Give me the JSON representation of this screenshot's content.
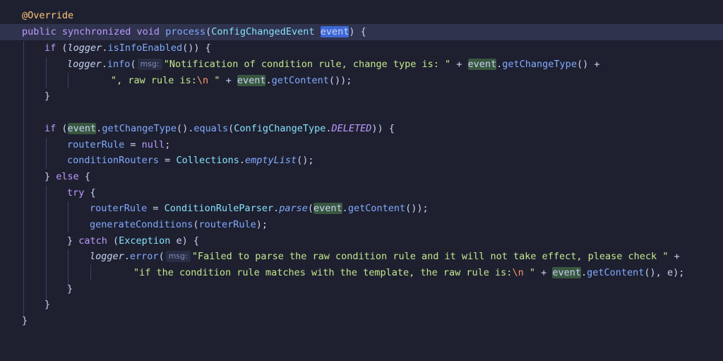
{
  "editor": {
    "theme_colors": {
      "background": "#1e2030",
      "current_line": "#2f334d",
      "keyword": "#c099ff",
      "string": "#c3e88d",
      "function": "#82aaff",
      "annotation": "#ffc777"
    },
    "param_hint": "msg:",
    "lines": {
      "l1": {
        "ann": "@Override"
      },
      "l2": {
        "kw": "public synchronized void ",
        "fn": "process",
        "p1": "(",
        "ty": "ConfigChangedEvent ",
        "var": "event",
        "p2": ") {"
      },
      "l3": {
        "kw": "if ",
        "p1": "(",
        "obj": "logger",
        "p2": ".",
        "fn": "isInfoEnabled",
        "p3": "()) {"
      },
      "l4": {
        "obj": "logger",
        "p1": ".",
        "fn": "info",
        "p2": "(",
        "str": "\"Notification of condition rule, change type is: \"",
        "op": " + ",
        "var": "event",
        "p3": ".",
        "fn2": "getChangeType",
        "p4": "() +"
      },
      "l5": {
        "str1": "\", raw rule is:",
        "esc": "\\n",
        "str2": " \"",
        "op": " + ",
        "var": "event",
        "p1": ".",
        "fn": "getContent",
        "p2": "());"
      },
      "l6": {
        "p1": "}"
      },
      "l8": {
        "kw": "if ",
        "p1": "(",
        "var": "event",
        "p2": ".",
        "fn": "getChangeType",
        "p3": "().",
        "fn2": "equals",
        "p4": "(",
        "ty": "ConfigChangeType",
        "p5": ".",
        "const": "DELETED",
        "p6": ")) {"
      },
      "l9": {
        "fld": "routerRule",
        "op": " = ",
        "kw": "null",
        "p1": ";"
      },
      "l10": {
        "fld": "conditionRouters",
        "op": " = ",
        "ty": "Collections",
        "p1": ".",
        "fn": "emptyList",
        "p2": "();"
      },
      "l11": {
        "p1": "} ",
        "kw": "else",
        "p2": " {"
      },
      "l12": {
        "kw": "try",
        "p1": " {"
      },
      "l13": {
        "fld": "routerRule",
        "op": " = ",
        "ty": "ConditionRuleParser",
        "p1": ".",
        "fn": "parse",
        "p2": "(",
        "var": "event",
        "p3": ".",
        "fn2": "getContent",
        "p4": "());"
      },
      "l14": {
        "fn": "generateConditions",
        "p1": "(",
        "fld": "routerRule",
        "p2": ");"
      },
      "l15": {
        "p1": "} ",
        "kw": "catch",
        "p2": " (",
        "ty": "Exception",
        "var": " e",
        "p3": ") {"
      },
      "l16": {
        "obj": "logger",
        "p1": ".",
        "fn": "error",
        "p2": "(",
        "str": "\"Failed to parse the raw condition rule and it will not take effect, please check \"",
        "op": " +"
      },
      "l17": {
        "str1": "\"if the condition rule matches with the template, the raw rule is:",
        "esc": "\\n",
        "str2": " \"",
        "op": " + ",
        "var": "event",
        "p1": ".",
        "fn": "getContent",
        "p2": "(), ",
        "var2": "e",
        "p3": ");"
      },
      "l18": {
        "p1": "}"
      },
      "l19": {
        "p1": "}"
      },
      "l20": {
        "p1": "}"
      }
    }
  }
}
